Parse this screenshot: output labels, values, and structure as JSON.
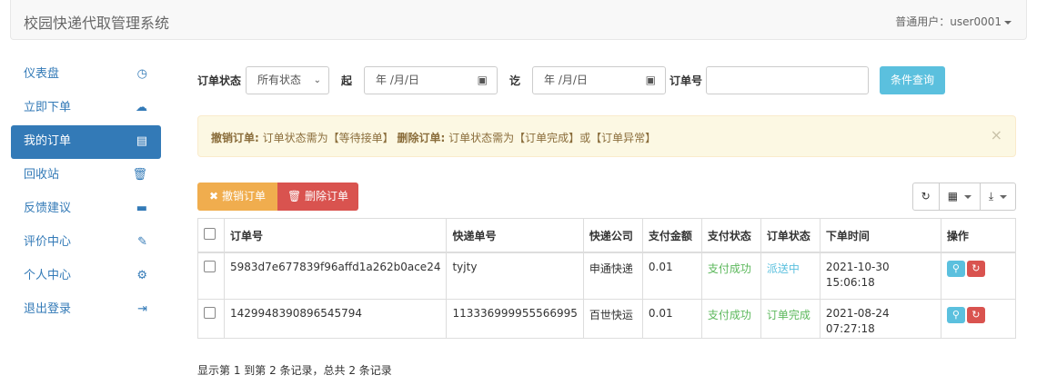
{
  "app": {
    "title": "校园快递代取管理系统"
  },
  "user": {
    "label": "普通用户：user0001"
  },
  "sidebar": {
    "items": [
      {
        "label": "仪表盘",
        "icon": "dashboard-icon",
        "glyph": "◷"
      },
      {
        "label": "立即下单",
        "icon": "cloud-upload-icon",
        "glyph": "☁"
      },
      {
        "label": "我的订单",
        "icon": "list-icon",
        "glyph": "▤",
        "active": true
      },
      {
        "label": "回收站",
        "icon": "trash-icon",
        "glyph": "🗑"
      },
      {
        "label": "反馈建议",
        "icon": "comment-icon",
        "glyph": "▬"
      },
      {
        "label": "评价中心",
        "icon": "edit-icon",
        "glyph": "✎"
      },
      {
        "label": "个人中心",
        "icon": "gear-icon",
        "glyph": "⚙"
      },
      {
        "label": "退出登录",
        "icon": "logout-icon",
        "glyph": "⇥"
      }
    ]
  },
  "filters": {
    "status_label": "订单状态",
    "status_value": "所有状态",
    "from_label": "起",
    "date_placeholder": "年 /月/日",
    "to_label": "讫",
    "order_no_label": "订单号",
    "order_no_value": "",
    "query_button": "条件查询"
  },
  "alert": {
    "cancel_title": "撤销订单:",
    "cancel_text": "订单状态需为【等待接单】",
    "delete_title": "删除订单:",
    "delete_text": "订单状态需为【订单完成】或【订单异常】",
    "close": "×"
  },
  "toolbar": {
    "cancel_button": "撤销订单",
    "delete_button": "删除订单",
    "refresh_icon": "refresh-icon",
    "columns_icon": "columns-icon",
    "export_icon": "export-icon"
  },
  "table": {
    "headers": [
      "订单号",
      "快递单号",
      "快递公司",
      "支付金额",
      "支付状态",
      "订单状态",
      "下单时间",
      "操作"
    ],
    "rows": [
      {
        "order_no": "5983d7e677839f96affd1a262b0ace24",
        "tracking_no": "tyjty",
        "company": "申通快递",
        "amount": "0.01",
        "pay_status": "支付成功",
        "order_status": "派送中",
        "date": "2021-10-30",
        "time": "15:06:18"
      },
      {
        "order_no": "1429948390896545794",
        "tracking_no": "113336999955566995",
        "company": "百世快运",
        "amount": "0.01",
        "pay_status": "支付成功",
        "order_status": "订单完成",
        "date": "2021-08-24",
        "time": "07:27:18"
      }
    ]
  },
  "pagination": {
    "info": "显示第 1 到第 2 条记录，总共 2 条记录"
  },
  "colors": {
    "primary": "#337ab7",
    "info": "#5bc0de",
    "warning": "#f0ad4e",
    "danger": "#d9534f",
    "success": "#5cb85c"
  }
}
